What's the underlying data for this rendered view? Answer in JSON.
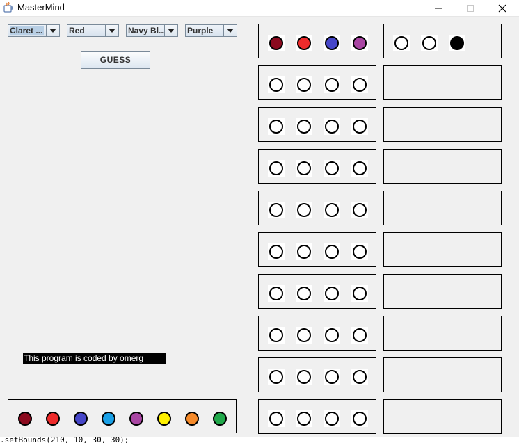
{
  "window": {
    "title": "MasterMind",
    "controls": [
      "minimize",
      "maximize",
      "close"
    ]
  },
  "dropdowns": [
    {
      "value": "Claret ...",
      "selected": true
    },
    {
      "value": "Red",
      "selected": false
    },
    {
      "value": "Navy Bl...",
      "selected": false
    },
    {
      "value": "Purple",
      "selected": false
    }
  ],
  "guess_button": "GUESS",
  "credit_text": "This program is coded by omerg",
  "colors": {
    "claret": "#8b0a1e",
    "red": "#ee2b2b",
    "navy_blue": "#4646c8",
    "cyan": "#1aa0e6",
    "purple": "#a946a3",
    "yellow": "#fff000",
    "orange": "#f58a2a",
    "green": "#20a84a",
    "empty": "#ffffff",
    "black": "#000000"
  },
  "palette": [
    "claret",
    "red",
    "navy_blue",
    "cyan",
    "purple",
    "yellow",
    "orange",
    "green"
  ],
  "board": {
    "rows": [
      {
        "guess": [
          "claret",
          "red",
          "navy_blue",
          "purple"
        ],
        "feedback": [
          "empty",
          "empty",
          "black"
        ]
      },
      {
        "guess": [
          "empty",
          "empty",
          "empty",
          "empty"
        ],
        "feedback": []
      },
      {
        "guess": [
          "empty",
          "empty",
          "empty",
          "empty"
        ],
        "feedback": []
      },
      {
        "guess": [
          "empty",
          "empty",
          "empty",
          "empty"
        ],
        "feedback": []
      },
      {
        "guess": [
          "empty",
          "empty",
          "empty",
          "empty"
        ],
        "feedback": []
      },
      {
        "guess": [
          "empty",
          "empty",
          "empty",
          "empty"
        ],
        "feedback": []
      },
      {
        "guess": [
          "empty",
          "empty",
          "empty",
          "empty"
        ],
        "feedback": []
      },
      {
        "guess": [
          "empty",
          "empty",
          "empty",
          "empty"
        ],
        "feedback": []
      },
      {
        "guess": [
          "empty",
          "empty",
          "empty",
          "empty"
        ],
        "feedback": []
      },
      {
        "guess": [
          "empty",
          "empty",
          "empty",
          "empty"
        ],
        "feedback": []
      }
    ]
  },
  "console_text": ".setBounds(210, 10, 30, 30);"
}
